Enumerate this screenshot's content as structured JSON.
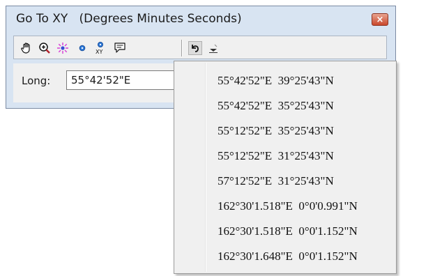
{
  "window": {
    "title": "Go To XY   (Degrees Minutes Seconds)",
    "close_label": "×"
  },
  "toolbar": {
    "icons": [
      "pan-icon",
      "zoom-to-icon",
      "flash-icon",
      "add-point-icon",
      "add-labeled-point-icon",
      "add-callout-icon",
      "recent-locations-icon",
      "dropdown-arrow-icon"
    ]
  },
  "form": {
    "long_label": "Long:",
    "long_value": "55°42'52\"E"
  },
  "recent_locations": [
    "55°42'52\"E  39°25'43\"N",
    "55°42'52\"E  35°25'43\"N",
    "55°12'52\"E  35°25'43\"N",
    "55°12'52\"E  31°25'43\"N",
    "57°12'52\"E  31°25'43\"N",
    "162°30'1.518\"E  0°0'0.991\"N",
    "162°30'1.518\"E  0°0'1.152\"N",
    "162°30'1.648\"E  0°0'1.152\"N"
  ]
}
